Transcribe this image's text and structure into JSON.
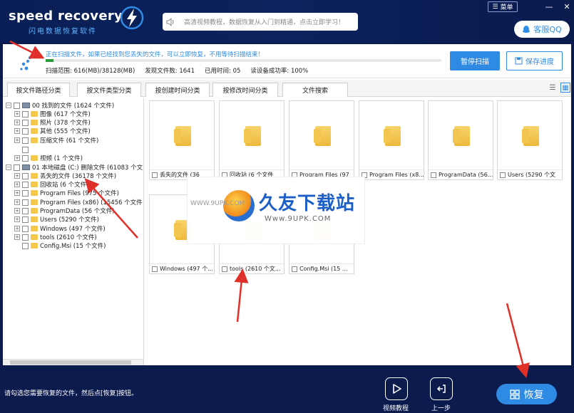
{
  "header": {
    "logo_title": "speed recovery",
    "logo_subtitle": "闪电数据恢复软件",
    "marquee_text": "高清视频教程，数据恢复从入门到精通，点击立即学习！",
    "menu_label": "菜单",
    "minimize": "—",
    "close": "✕",
    "service_label": "客服QQ"
  },
  "scan": {
    "message": "正在扫描文件，如果已经找到您丢失的文件，可以立即恢复，不用等待扫描结束！",
    "progress": 0.02,
    "range": "扫描范围: 616(MB)/38128(MB)",
    "found": "发现文件数: 1641",
    "elapsed": "已用时间: 05",
    "success_rate": "读设备成功率: 100%",
    "pause_label": "暂停扫描",
    "save_label": "保存进度"
  },
  "tabs": [
    "按文件路径分类",
    "按文件类型分类",
    "按创建时间分类",
    "按修改时间分类",
    "文件搜索"
  ],
  "tree": [
    {
      "level": 0,
      "expander": "−",
      "type": "drive",
      "label": "00 找到的文件 (1624 个文件)"
    },
    {
      "level": 1,
      "expander": "+",
      "type": "folder",
      "label": "图像    (617 个文件)"
    },
    {
      "level": 1,
      "expander": "+",
      "type": "folder",
      "label": "照片    (378 个文件)"
    },
    {
      "level": 1,
      "expander": "+",
      "type": "folder",
      "label": "其他    (555 个文件)"
    },
    {
      "level": 1,
      "expander": "+",
      "type": "folder",
      "label": "压缩文件    (61 个文件)"
    },
    {
      "level": 1,
      "expander": "",
      "type": "empty",
      "label": ""
    },
    {
      "level": 1,
      "expander": "+",
      "type": "folder",
      "label": "视频    (1 个文件)"
    },
    {
      "level": 0,
      "expander": "−",
      "type": "drive",
      "label": "01 本地磁盘 (C:) 删除文件 (61083 个文"
    },
    {
      "level": 1,
      "expander": "+",
      "type": "folder",
      "label": "丢失的文件    (36178 个文件)"
    },
    {
      "level": 1,
      "expander": "+",
      "type": "folder",
      "label": "回收站    (6 个文件)"
    },
    {
      "level": 1,
      "expander": "+",
      "type": "folder",
      "label": "Program Files    (975 个文件)"
    },
    {
      "level": 1,
      "expander": "+",
      "type": "folder",
      "label": "Program Files (x86)    (15456 个文件"
    },
    {
      "level": 1,
      "expander": "+",
      "type": "folder",
      "label": "ProgramData    (56 个文件)"
    },
    {
      "level": 1,
      "expander": "+",
      "type": "folder",
      "label": "Users    (5290 个文件)"
    },
    {
      "level": 1,
      "expander": "+",
      "type": "folder",
      "label": "Windows    (497 个文件)"
    },
    {
      "level": 1,
      "expander": "+",
      "type": "folder",
      "label": "tools    (2610 个文件)"
    },
    {
      "level": 1,
      "expander": "",
      "type": "folder",
      "label": "Config.Msi    (15 个文件)"
    }
  ],
  "cards": [
    "丢失的文件 (36",
    "回收站 (6 个文件",
    "Program Files (97",
    "Program Files (x8...",
    "ProgramData (56...",
    "Users (5290 个文",
    "Windows (497 个...",
    "tools (2610 个文...",
    "Config.Msi (15 ..."
  ],
  "watermark": {
    "title": "久友下载站",
    "url_small": "WWW.9UPK.COM",
    "url_large": "Www.9UPK.COM"
  },
  "footer": {
    "hint": "请勾选您需要恢复的文件，然后点[恢复]按钮。",
    "video_label": "视频教程",
    "back_label": "上一步",
    "recover_label": "恢复"
  },
  "colors": {
    "background": "#0b1b4d",
    "accent": "#2f8ae4",
    "progress": "#2e9b3a",
    "folder": "#f5c84c",
    "annotation_arrow": "#e0302a"
  },
  "icons": {
    "bolt": "lightning-bolt-icon",
    "speaker": "speaker-icon",
    "qq": "qq-penguin-icon",
    "scan": "scan-dots-icon",
    "video": "play-icon",
    "back": "back-arrow-icon",
    "recover": "recover-grid-icon"
  }
}
